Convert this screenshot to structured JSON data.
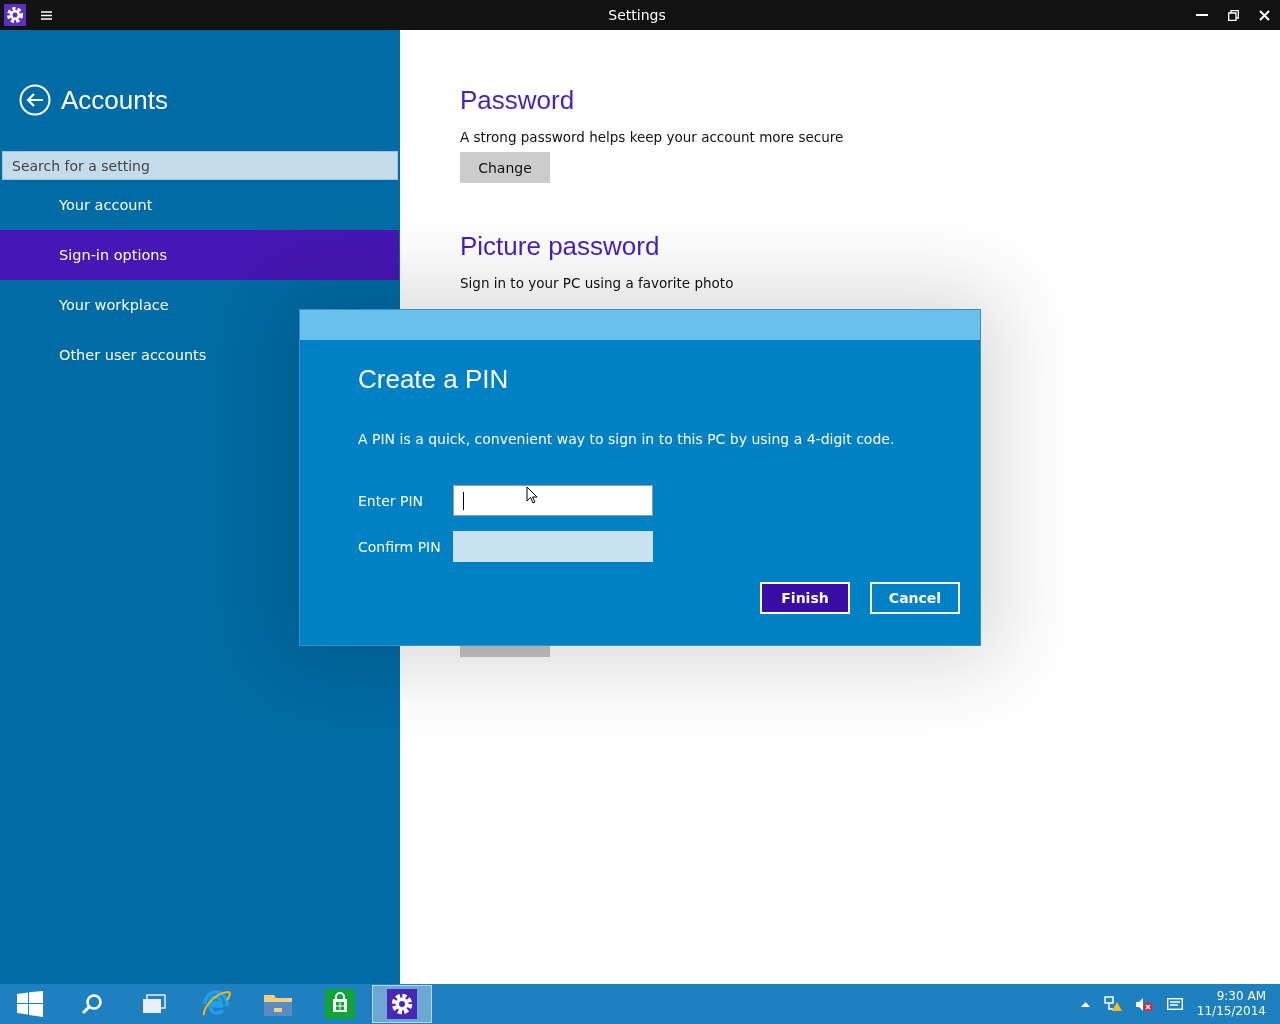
{
  "window": {
    "title": "Settings"
  },
  "sidebar": {
    "title": "Accounts",
    "search": {
      "placeholder": "Search for a setting"
    },
    "items": [
      {
        "label": "Your account",
        "selected": false
      },
      {
        "label": "Sign-in options",
        "selected": true
      },
      {
        "label": "Your workplace",
        "selected": false
      },
      {
        "label": "Other user accounts",
        "selected": false
      }
    ]
  },
  "content": {
    "sections": [
      {
        "heading": "Password",
        "description": "A strong password helps keep your account more secure",
        "button": "Change"
      },
      {
        "heading": "Picture password",
        "description": "Sign in to your PC using a favorite photo"
      }
    ]
  },
  "dialog": {
    "title": "Create a PIN",
    "description": "A PIN is a quick, convenient way to sign in to this PC by using a 4-digit code.",
    "fields": [
      {
        "label": "Enter PIN",
        "focused": true
      },
      {
        "label": "Confirm PIN",
        "focused": false
      }
    ],
    "buttons": [
      {
        "label": "Finish",
        "kind": "primary"
      },
      {
        "label": "Cancel",
        "kind": "secondary"
      }
    ]
  },
  "taskbar": {
    "apps": [
      {
        "kind": "start",
        "selected": false
      },
      {
        "kind": "search",
        "selected": false
      },
      {
        "kind": "taskview",
        "selected": false
      },
      {
        "kind": "browser",
        "selected": false
      },
      {
        "kind": "folder",
        "selected": false
      },
      {
        "kind": "store",
        "selected": false
      },
      {
        "kind": "settings",
        "selected": true
      }
    ],
    "clock": {
      "time": "9:30 AM",
      "date": "11/15/2014"
    }
  }
}
